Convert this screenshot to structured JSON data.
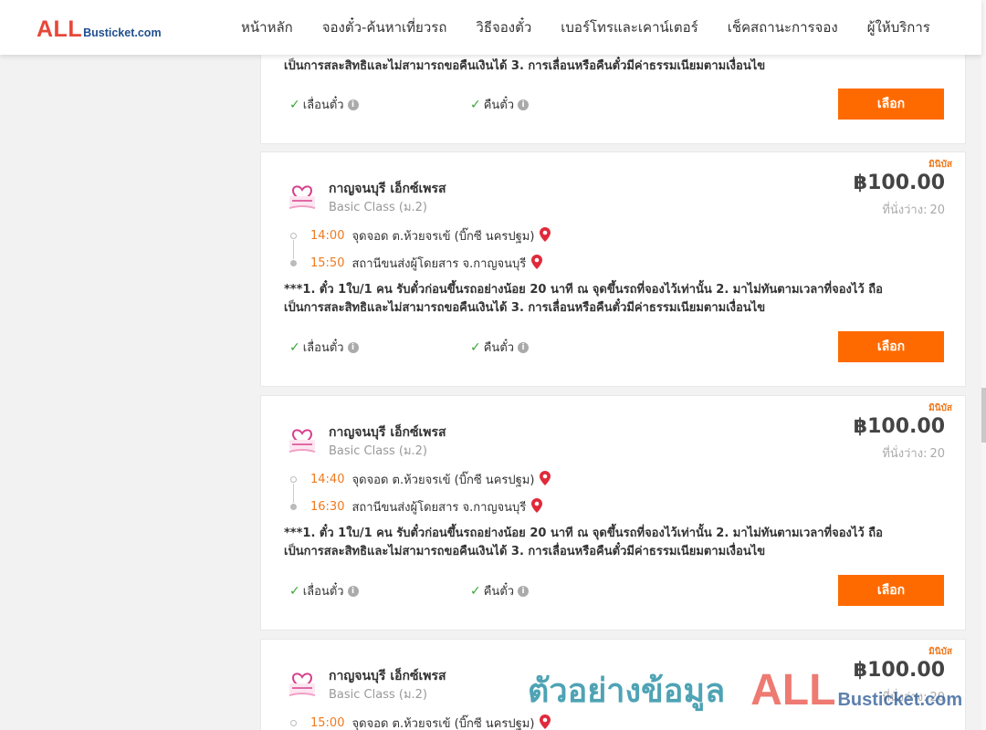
{
  "header": {
    "logo_all": "ALL",
    "logo_rest": "Busticket.com",
    "nav": [
      "หน้าหลัก",
      "จองตั๋ว-ค้นหาเที่ยวรถ",
      "วิธีจองตั๋ว",
      "เบอร์โทรและเคาน์เตอร์",
      "เช็คสถานะการจอง",
      "ผู้ให้บริการ"
    ]
  },
  "cards": [
    {
      "notice_line2": "เป็นการสละสิทธิและไม่สามารถขอคืนเงินได้ 3. การเลื่อนหรือคืนตั๋วมีค่าธรรมเนียมตามเงื่อนไข",
      "feature_1": "เลื่อนตั๋ว",
      "feature_2": "คืนตั๋ว",
      "select_label": "เลือก"
    },
    {
      "tag": "มินิบัส",
      "operator": "กาญจนบุรี เอ็กซ์เพรส",
      "class": "Basic Class (ม.2)",
      "price": "฿100.00",
      "seats_label": "ที่นั่งว่าง:",
      "seats": "20",
      "depart_time": "14:00",
      "depart_place": "จุดจอด ต.ห้วยจรเข้ (บิ๊กซี นครปฐม)",
      "arrive_time": "15:50",
      "arrive_place": "สถานีขนส่งผู้โดยสาร จ.กาญจนบุรี",
      "notice_line1": "***1. ตั๋ว 1ใบ/1 คน รับตั๋วก่อนขึ้นรถอย่างน้อย 20 นาที ณ จุดขึ้นรถที่จองไว้เท่านั้น 2. มาไม่ทันตามเวลาที่จองไว้ ถือ",
      "notice_line2": "เป็นการสละสิทธิและไม่สามารถขอคืนเงินได้ 3. การเลื่อนหรือคืนตั๋วมีค่าธรรมเนียมตามเงื่อนไข",
      "feature_1": "เลื่อนตั๋ว",
      "feature_2": "คืนตั๋ว",
      "select_label": "เลือก"
    },
    {
      "tag": "มินิบัส",
      "operator": "กาญจนบุรี เอ็กซ์เพรส",
      "class": "Basic Class (ม.2)",
      "price": "฿100.00",
      "seats_label": "ที่นั่งว่าง:",
      "seats": "20",
      "depart_time": "14:40",
      "depart_place": "จุดจอด ต.ห้วยจรเข้ (บิ๊กซี นครปฐม)",
      "arrive_time": "16:30",
      "arrive_place": "สถานีขนส่งผู้โดยสาร จ.กาญจนบุรี",
      "notice_line1": "***1. ตั๋ว 1ใบ/1 คน รับตั๋วก่อนขึ้นรถอย่างน้อย 20 นาที ณ จุดขึ้นรถที่จองไว้เท่านั้น 2. มาไม่ทันตามเวลาที่จองไว้ ถือ",
      "notice_line2": "เป็นการสละสิทธิและไม่สามารถขอคืนเงินได้ 3. การเลื่อนหรือคืนตั๋วมีค่าธรรมเนียมตามเงื่อนไข",
      "feature_1": "เลื่อนตั๋ว",
      "feature_2": "คืนตั๋ว",
      "select_label": "เลือก"
    },
    {
      "tag": "มินิบัส",
      "operator": "กาญจนบุรี เอ็กซ์เพรส",
      "class": "Basic Class (ม.2)",
      "price": "฿100.00",
      "seats_label": "ที่นั่งว่าง:",
      "seats": "20",
      "depart_time": "15:00",
      "depart_place": "จุดจอด ต.ห้วยจรเข้ (บิ๊กซี นครปฐม)"
    }
  ],
  "watermark": {
    "text": "ตัวอย่างข้อมูล",
    "logo_all": "ALL",
    "logo_rest": "Busticket.com"
  },
  "colors": {
    "accent": "#ff6a00",
    "time": "#ef7a1f",
    "check": "#3aa53a",
    "pin": "#e02a3a",
    "logo_red": "#e8473a",
    "logo_blue": "#1f4f8f"
  }
}
